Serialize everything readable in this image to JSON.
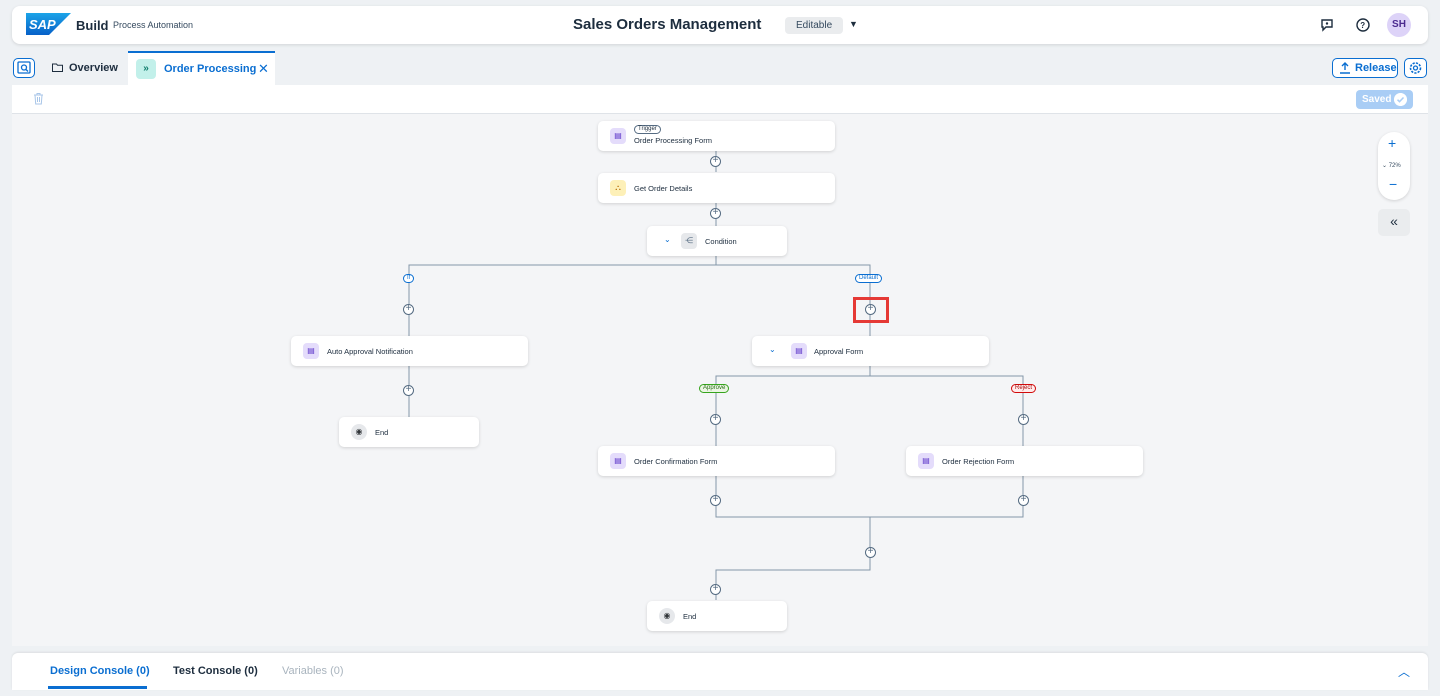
{
  "shell": {
    "brand": "Build",
    "product": "Process Automation",
    "project_title": "Sales Orders Management",
    "status": "Editable",
    "avatar_initials": "SH"
  },
  "tabs": {
    "overview": "Overview",
    "order_processing": "Order Processing"
  },
  "actions": {
    "release": "Release",
    "saved": "Saved"
  },
  "canvas": {
    "zoom": "72%",
    "nodes": {
      "trigger_badge": "Trigger",
      "trigger": "Order Processing Form",
      "get_details": "Get Order Details",
      "condition": "Condition",
      "auto_approval": "Auto Approval Notification",
      "end_left": "End",
      "approval_form": "Approval Form",
      "confirmation": "Order Confirmation Form",
      "rejection": "Order Rejection Form",
      "end_bottom": "End"
    },
    "branches": {
      "if": "If",
      "default": "Default",
      "approve": "Approve",
      "reject": "Reject"
    }
  },
  "console": {
    "design": "Design Console (0)",
    "test": "Test Console (0)",
    "variables": "Variables (0)"
  },
  "colors": {
    "accent": "#0a6ed1",
    "highlight": "#e53935"
  }
}
